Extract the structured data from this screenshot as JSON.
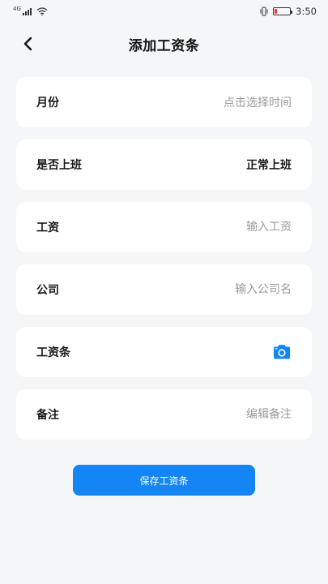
{
  "status_bar": {
    "network": "4G",
    "time": "3:50",
    "battery_color": "#e53935"
  },
  "header": {
    "back_icon": "chevron-left-icon",
    "title": "添加工资条"
  },
  "form": {
    "month": {
      "label": "月份",
      "placeholder": "点击选择时间"
    },
    "attendance": {
      "label": "是否上班",
      "value": "正常上班"
    },
    "salary": {
      "label": "工资",
      "placeholder": "输入工资"
    },
    "company": {
      "label": "公司",
      "placeholder": "输入公司名"
    },
    "payslip": {
      "label": "工资条",
      "icon": "camera-icon",
      "icon_color": "#1485f5"
    },
    "remark": {
      "label": "备注",
      "placeholder": "编辑备注"
    }
  },
  "actions": {
    "save_label": "保存工资条",
    "accent_color": "#1485f5"
  }
}
